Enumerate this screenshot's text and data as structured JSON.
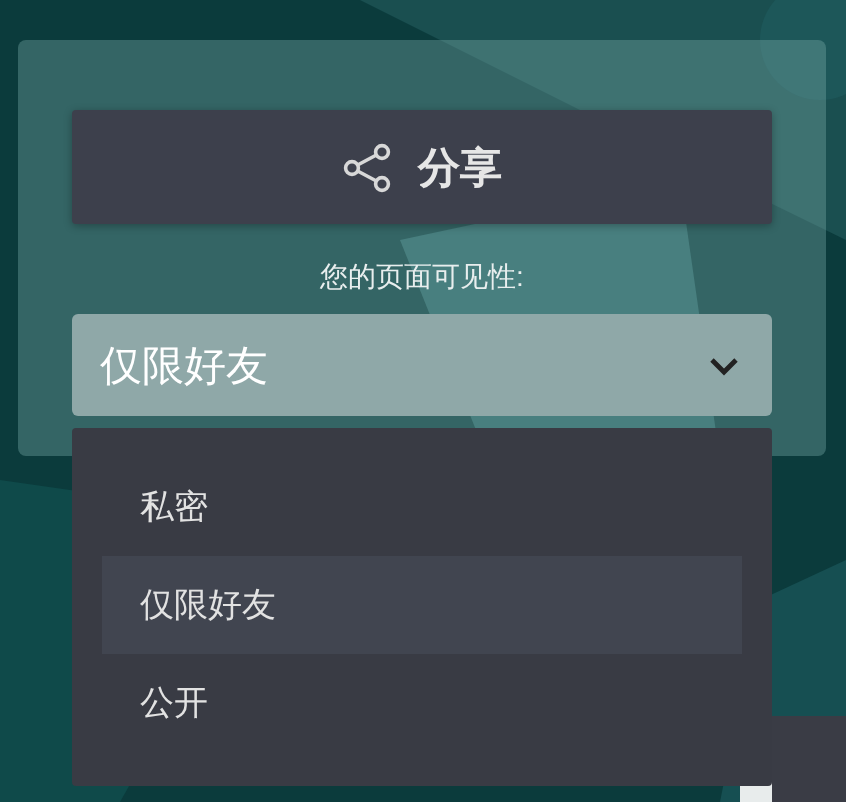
{
  "share_button": {
    "label": "分享"
  },
  "visibility": {
    "label": "您的页面可见性:",
    "value": "仅限好友",
    "expanded": true,
    "options": [
      {
        "label": "私密",
        "selected": false
      },
      {
        "label": "仅限好友",
        "selected": true
      },
      {
        "label": "公开",
        "selected": false
      }
    ]
  }
}
